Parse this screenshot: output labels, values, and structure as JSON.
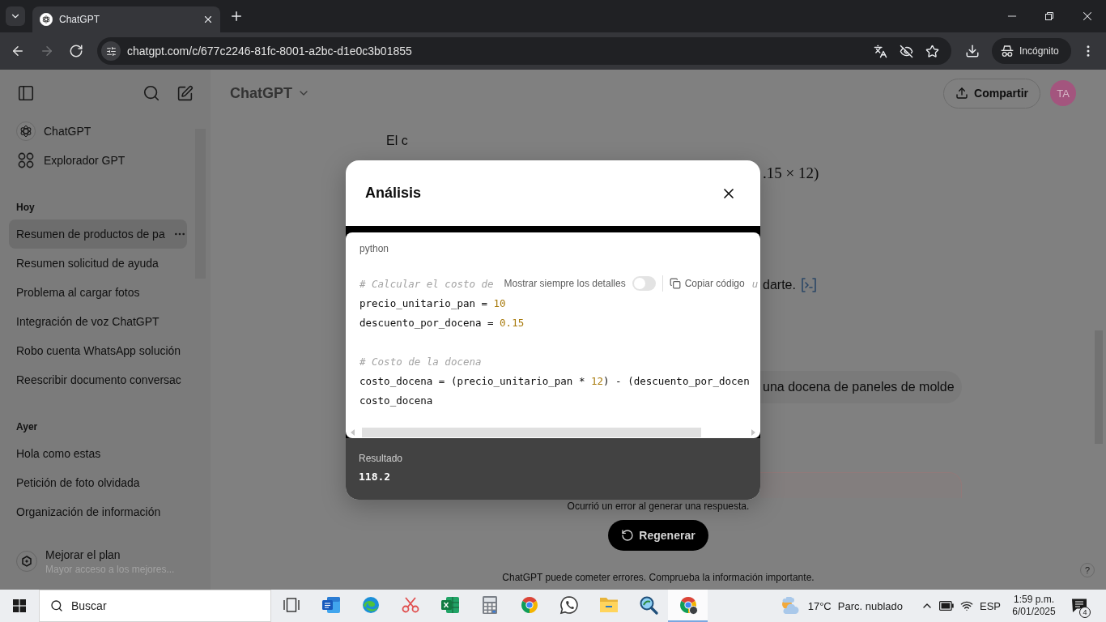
{
  "browser": {
    "tabs": [
      {
        "title": "ChatGPT",
        "selected": true
      }
    ],
    "nav_buttons": [
      {
        "kind": "back",
        "disabled": false
      },
      {
        "kind": "forward",
        "disabled": true
      },
      {
        "kind": "reload",
        "disabled": false
      }
    ],
    "url": "chatgpt.com/c/677c2246-81fc-8001-a2bc-d1e0c3b01855",
    "profile_label": "Incógnito"
  },
  "sidebar": {
    "top_items": [
      {
        "kind": "logo",
        "label": "ChatGPT"
      },
      {
        "kind": "explore",
        "label": "Explorador GPT"
      }
    ],
    "sections": [
      {
        "title": "Hoy",
        "items": [
          {
            "label": "Resumen de productos de pa",
            "selected": true
          },
          {
            "label": "Resumen solicitud de ayuda",
            "selected": false
          },
          {
            "label": "Problema al cargar fotos",
            "selected": false
          },
          {
            "label": "Integración de voz ChatGPT",
            "selected": false
          },
          {
            "label": "Robo cuenta WhatsApp solución",
            "selected": false
          },
          {
            "label": "Reescribir documento conversac",
            "selected": false
          }
        ]
      },
      {
        "title": "Ayer",
        "items": [
          {
            "label": "Hola como estas",
            "selected": false
          },
          {
            "label": "Petición de foto olvidada",
            "selected": false
          },
          {
            "label": "Organización de información",
            "selected": false
          }
        ]
      }
    ],
    "upgrade": {
      "title": "Mejorar el plan",
      "subtitle": "Mayor acceso a los mejores..."
    }
  },
  "header": {
    "model_label": "ChatGPT",
    "share_label": "Compartir",
    "avatar_initials": "TA"
  },
  "chat": {
    "fragments": [
      {
        "kind": "text",
        "text": "El c"
      },
      {
        "kind": "math",
        "text": ".15 × 12)"
      },
      {
        "kind": "text_with_icon",
        "text": "darte."
      },
      {
        "kind": "user_bubble",
        "text": "una docena de paneles de molde"
      },
      {
        "kind": "error_box"
      }
    ]
  },
  "footer": {
    "error": "Ocurrió un error al generar una respuesta.",
    "regenerate_label": "Regenerar",
    "disclaimer": "ChatGPT puede cometer errores. Comprueba la información importante.",
    "help_label": "?"
  },
  "modal": {
    "title": "Análisis",
    "language": "python",
    "toolbar": {
      "label": "Mostrar siempre los detalles",
      "on": false,
      "copy_label": "Copiar código"
    },
    "code_lines": [
      {
        "kind": "code",
        "tokens": [
          {
            "kind": "comment",
            "text": "# Calcular el costo de"
          },
          {
            "kind": "toolbar"
          },
          {
            "kind": "comment",
            "text": "u"
          }
        ]
      },
      {
        "kind": "code",
        "tokens": [
          {
            "kind": "plain",
            "text": "precio_unitario_pan = "
          },
          {
            "kind": "number",
            "text": "10"
          }
        ]
      },
      {
        "kind": "code",
        "tokens": [
          {
            "kind": "plain",
            "text": "descuento_por_docena = "
          },
          {
            "kind": "number",
            "text": "0.15"
          }
        ]
      },
      {
        "kind": "blank"
      },
      {
        "kind": "code",
        "tokens": [
          {
            "kind": "comment",
            "text": "# Costo de la docena"
          }
        ]
      },
      {
        "kind": "code",
        "tokens": [
          {
            "kind": "plain",
            "text": "costo_docena = (precio_unitario_pan * "
          },
          {
            "kind": "number",
            "text": "12"
          },
          {
            "kind": "plain",
            "text": ") - (descuento_por_docen"
          }
        ]
      },
      {
        "kind": "code",
        "tokens": [
          {
            "kind": "plain",
            "text": "costo_docena"
          }
        ]
      }
    ],
    "result_label": "Resultado",
    "result_value": "118.2"
  },
  "taskbar": {
    "search_placeholder": "Buscar",
    "apps": [
      {
        "kind": "task_view",
        "selected": false
      },
      {
        "kind": "document",
        "selected": false
      },
      {
        "kind": "swirl",
        "selected": false
      },
      {
        "kind": "scissors",
        "selected": false
      },
      {
        "kind": "spreadsheet",
        "selected": false
      },
      {
        "kind": "calculator",
        "selected": false
      },
      {
        "kind": "browser",
        "selected": false
      },
      {
        "kind": "chat",
        "selected": false
      },
      {
        "kind": "folder",
        "selected": false
      },
      {
        "kind": "magnifier",
        "selected": false
      },
      {
        "kind": "browser_profile",
        "selected": true
      }
    ],
    "weather": {
      "temperature": "17°C",
      "condition": "Parc. nublado"
    },
    "language": "ESP",
    "time": "1:59 p.m.",
    "date": "6/01/2025",
    "notifications": "4"
  }
}
